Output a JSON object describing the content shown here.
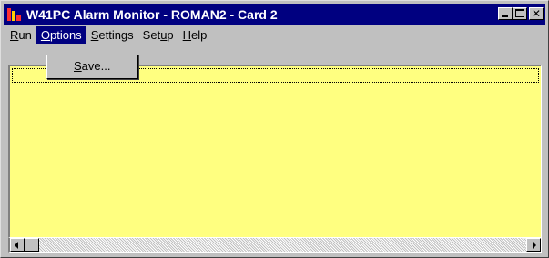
{
  "window": {
    "title": "W41PC Alarm Monitor - ROMAN2 - Card 2"
  },
  "icons": {
    "app": "alarm-monitor-app-icon",
    "minimize": "minimize-icon",
    "maximize": "maximize-icon",
    "close": "close-icon",
    "scroll_left": "arrow-left-icon",
    "scroll_right": "arrow-right-icon"
  },
  "menubar": {
    "items": [
      {
        "label": "Run",
        "underline": "R"
      },
      {
        "label": "Options",
        "underline": "O"
      },
      {
        "label": "Settings",
        "underline": "S"
      },
      {
        "label": "Setup",
        "underline": "u"
      },
      {
        "label": "Help",
        "underline": "H"
      }
    ]
  },
  "options_menu": {
    "items": [
      {
        "label": "Save..."
      }
    ]
  },
  "colors": {
    "titlebar": "#000080",
    "client_background": "#ffff80",
    "chrome": "#c0c0c0"
  }
}
